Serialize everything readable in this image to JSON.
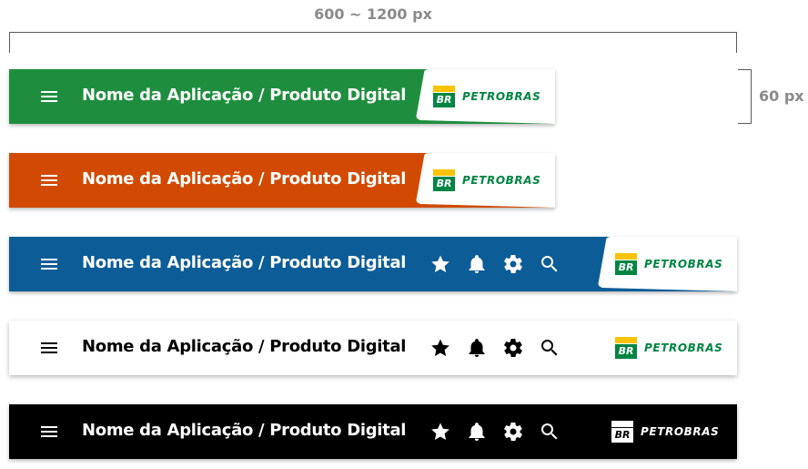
{
  "spec": {
    "width_label": "600 ~ 1200 px",
    "height_label": "60 px"
  },
  "header": {
    "app_title": "Nome da Aplicação / Produto Digital",
    "brand_mark": "BR",
    "brand_name": "PETROBRAS"
  },
  "variants": [
    {
      "id": "green",
      "color": "#1e8e3e",
      "actions": false
    },
    {
      "id": "orange",
      "color": "#d24a01",
      "actions": false
    },
    {
      "id": "blue",
      "color": "#0b5c97",
      "actions": [
        "star-icon",
        "bell-icon",
        "gear-icon",
        "search-icon"
      ]
    },
    {
      "id": "white",
      "color": "#ffffff",
      "actions": [
        "star-icon",
        "bell-icon",
        "gear-icon",
        "search-icon"
      ]
    },
    {
      "id": "black",
      "color": "#000000",
      "actions": [
        "star-icon",
        "bell-icon",
        "gear-icon",
        "search-icon"
      ]
    }
  ],
  "colors": {
    "brand_green": "#008542",
    "brand_yellow": "#f9c300",
    "annotation_gray": "#8a8a8a"
  }
}
